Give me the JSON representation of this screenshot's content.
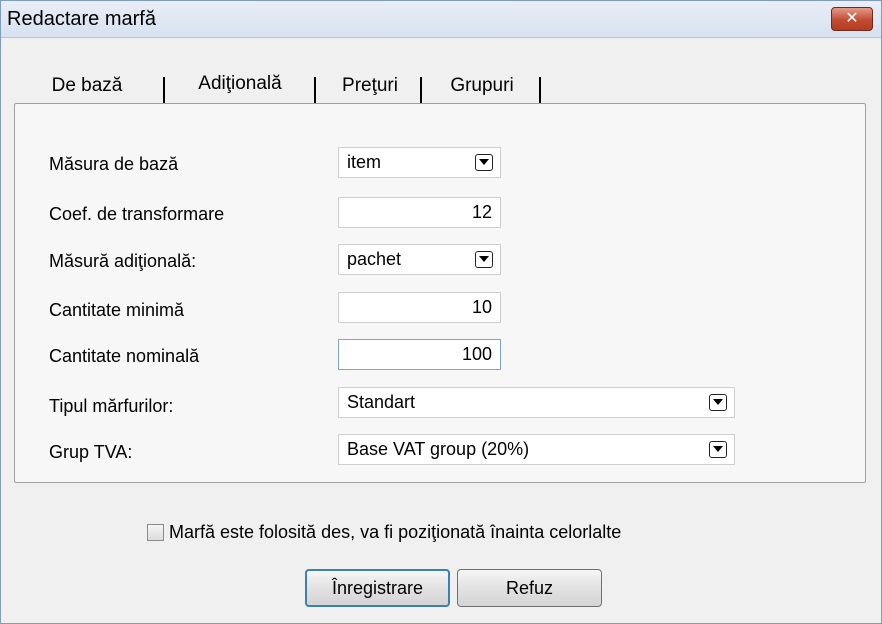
{
  "window": {
    "title": "Redactare marfă",
    "close_label": "✕"
  },
  "tabs": [
    {
      "label": "De bază"
    },
    {
      "label": "Adiţională"
    },
    {
      "label": "Preţuri"
    },
    {
      "label": "Grupuri"
    }
  ],
  "form": {
    "base_measure": {
      "label": "Măsura de bază",
      "value": "item"
    },
    "conversion": {
      "label": "Coef. de transformare",
      "value": "12"
    },
    "extra_measure": {
      "label": "Măsură adiţională:",
      "value": "pachet"
    },
    "min_qty": {
      "label": "Cantitate minimă",
      "value": "10"
    },
    "nominal_qty": {
      "label": "Cantitate nominală",
      "value": "100"
    },
    "goods_type": {
      "label": "Tipul mărfurilor:",
      "value": "Standart"
    },
    "vat_group": {
      "label": "Grup TVA:",
      "value": "Base VAT group (20%)"
    }
  },
  "frequent_checkbox": {
    "label": "Marfă  este folosită des, va fi poziţionată înainta celorlalte",
    "checked": false
  },
  "buttons": {
    "save": "Înregistrare",
    "cancel": "Refuz"
  }
}
